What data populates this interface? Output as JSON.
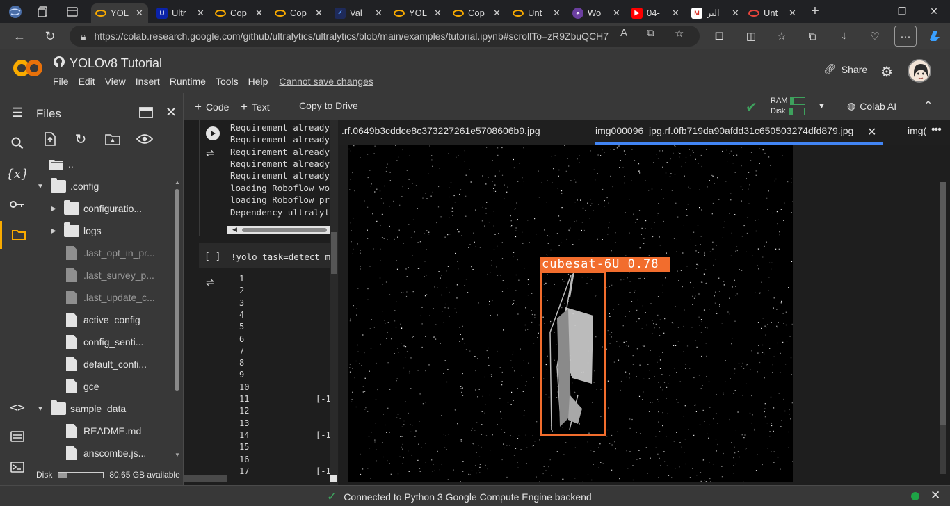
{
  "browser": {
    "tabs": [
      {
        "label": "YOL",
        "icon": "colab-icon",
        "active": true
      },
      {
        "label": "Ultr",
        "icon": "ultralytics-icon"
      },
      {
        "label": "Cop",
        "icon": "colab-icon"
      },
      {
        "label": "Cop",
        "icon": "colab-icon"
      },
      {
        "label": "Val",
        "icon": "val-icon"
      },
      {
        "label": "YOL",
        "icon": "colab-icon"
      },
      {
        "label": "Cop",
        "icon": "colab-icon"
      },
      {
        "label": "Unt",
        "icon": "colab-icon"
      },
      {
        "label": "Wo",
        "icon": "wo-icon"
      },
      {
        "label": "04-",
        "icon": "youtube-icon"
      },
      {
        "label": "البر",
        "icon": "gmail-icon"
      },
      {
        "label": "Unt",
        "icon": "untitled-icon"
      }
    ],
    "url": "https://colab.research.google.com/github/ultralytics/ultralytics/blob/main/examples/tutorial.ipynb#scrollTo=zR9ZbuQCH7FX"
  },
  "colab": {
    "title": "YOLOv8 Tutorial",
    "menu": [
      "File",
      "Edit",
      "View",
      "Insert",
      "Runtime",
      "Tools",
      "Help"
    ],
    "cannot_save": "Cannot save changes",
    "share_label": "Share"
  },
  "toolbar": {
    "code_label": "Code",
    "text_label": "Text",
    "copy_drive_label": "Copy to Drive",
    "ram_label": "RAM",
    "disk_label": "Disk",
    "colab_ai_label": "Colab AI"
  },
  "files": {
    "title": "Files",
    "items": [
      {
        "name": "..",
        "type": "folder-up",
        "indent": 0
      },
      {
        "name": ".config",
        "type": "folder",
        "expanded": true,
        "indent": 0
      },
      {
        "name": "configuratio...",
        "type": "folder",
        "expanded": false,
        "indent": 1
      },
      {
        "name": "logs",
        "type": "folder",
        "expanded": false,
        "indent": 1
      },
      {
        "name": ".last_opt_in_pr...",
        "type": "file",
        "dim": true,
        "indent": 1
      },
      {
        "name": ".last_survey_p...",
        "type": "file",
        "dim": true,
        "indent": 1
      },
      {
        "name": ".last_update_c...",
        "type": "file",
        "dim": true,
        "indent": 1
      },
      {
        "name": "active_config",
        "type": "file",
        "indent": 1
      },
      {
        "name": "config_senti...",
        "type": "file",
        "indent": 1
      },
      {
        "name": "default_confi...",
        "type": "file",
        "indent": 1
      },
      {
        "name": "gce",
        "type": "file",
        "indent": 1
      },
      {
        "name": "sample_data",
        "type": "folder",
        "expanded": true,
        "indent": 0
      },
      {
        "name": "README.md",
        "type": "file",
        "indent": 1
      },
      {
        "name": "anscombe.js...",
        "type": "file",
        "indent": 1
      }
    ],
    "disk_label": "Disk",
    "disk_available": "80.65 GB available",
    "disk_used_fraction": 0.2
  },
  "cell1": {
    "output_lines": [
      "Requirement already",
      "Requirement already",
      "Requirement already",
      "Requirement already",
      "Requirement already",
      "loading Roboflow wo",
      "loading Roboflow pr",
      "Dependency ultralyt"
    ]
  },
  "cell2": {
    "bracket": "[ ]",
    "code": "!yolo task=detect m",
    "line_numbers": [
      "1",
      "2",
      "3",
      "4",
      "5",
      "6",
      "7",
      "8",
      "9",
      "10",
      "11",
      "12",
      "13",
      "14",
      "15",
      "16",
      "17"
    ],
    "values": [
      {
        "line": "11",
        "text": "[-1"
      },
      {
        "line": "14",
        "text": "[-1"
      },
      {
        "line": "17",
        "text": "[-1"
      }
    ]
  },
  "viewer": {
    "tabs": [
      ".rf.0649b3cddce8c373227261e5708606b9.jpg",
      "img000096_jpg.rf.0fb719da90afdd31c650503274dfd879.jpg",
      "img("
    ],
    "detection_label": "cubesat-6U 0.78",
    "box_color": "#f26d2d"
  },
  "status": {
    "text": "Connected to Python 3 Google Compute Engine backend"
  }
}
